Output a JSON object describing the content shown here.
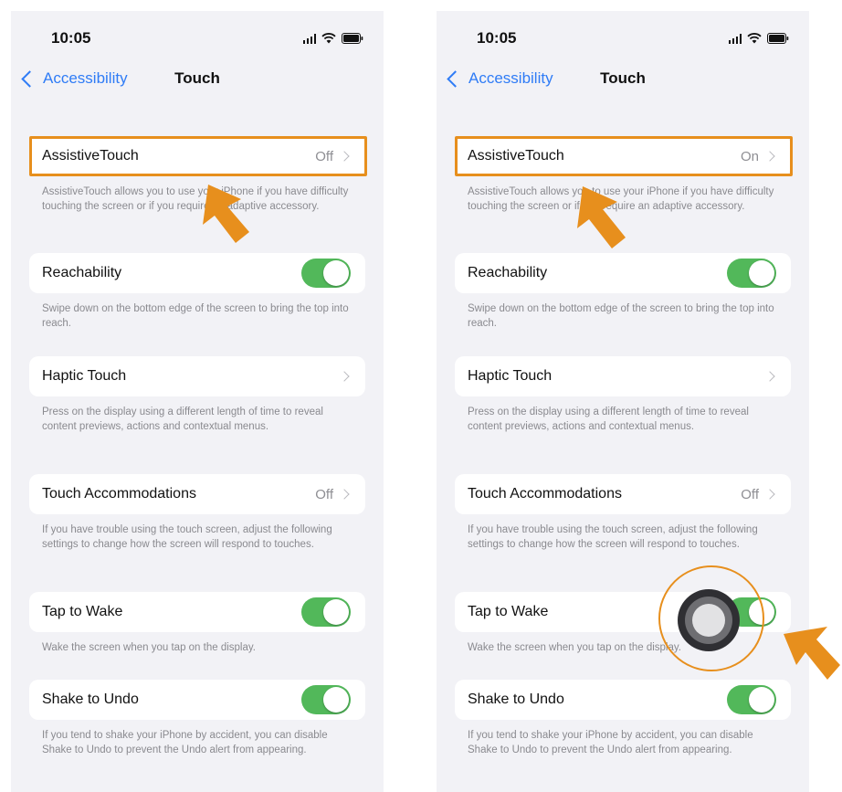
{
  "colors": {
    "accent_blue": "#2f7cf6",
    "toggle_green": "#52b85a",
    "highlight_orange": "#e78f1d",
    "background": "#f2f2f6"
  },
  "screens": [
    {
      "status": {
        "time": "10:05"
      },
      "nav": {
        "back_label": "Accessibility",
        "title": "Touch"
      },
      "cells": [
        {
          "label": "AssistiveTouch",
          "value": "Off",
          "footer": "AssistiveTouch allows you to use your iPhone if you have difficulty touching the screen or if you require an adaptive accessory."
        },
        {
          "label": "Reachability",
          "toggle": true,
          "footer": "Swipe down on the bottom edge of the screen to bring the top into reach."
        },
        {
          "label": "Haptic Touch",
          "value": "",
          "footer": "Press on the display using a different length of time to reveal content previews, actions and contextual menus."
        },
        {
          "label": "Touch Accommodations",
          "value": "Off",
          "footer": "If you have trouble using the touch screen, adjust the following settings to change how the screen will respond to touches."
        },
        {
          "label": "Tap to Wake",
          "toggle": true,
          "footer": "Wake the screen when you tap on the display."
        },
        {
          "label": "Shake to Undo",
          "toggle": true,
          "footer": "If you tend to shake your iPhone by accident, you can disable Shake to Undo to prevent the Undo alert from appearing."
        }
      ]
    },
    {
      "status": {
        "time": "10:05"
      },
      "nav": {
        "back_label": "Accessibility",
        "title": "Touch"
      },
      "cells": [
        {
          "label": "AssistiveTouch",
          "value": "On",
          "footer": "AssistiveTouch allows you to use your iPhone if you have difficulty touching the screen or if you require an adaptive accessory."
        },
        {
          "label": "Reachability",
          "toggle": true,
          "footer": "Swipe down on the bottom edge of the screen to bring the top into reach."
        },
        {
          "label": "Haptic Touch",
          "value": "",
          "footer": "Press on the display using a different length of time to reveal content previews, actions and contextual menus."
        },
        {
          "label": "Touch Accommodations",
          "value": "Off",
          "footer": "If you have trouble using the touch screen, adjust the following settings to change how the screen will respond to touches."
        },
        {
          "label": "Tap to Wake",
          "toggle": true,
          "footer": "Wake the screen when you tap on the display."
        },
        {
          "label": "Shake to Undo",
          "toggle": true,
          "footer": "If you tend to shake your iPhone by accident, you can disable Shake to Undo to prevent the Undo alert from appearing."
        }
      ]
    }
  ]
}
